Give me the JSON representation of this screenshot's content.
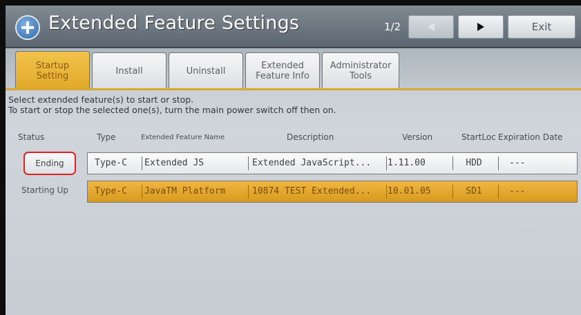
{
  "header": {
    "title": "Extended Feature Settings",
    "page_indicator": "1/2",
    "prev_icon": "triangle-left-icon",
    "next_icon": "triangle-right-icon",
    "exit_label": "Exit"
  },
  "tabs": [
    {
      "line1": "Startup",
      "line2": "Setting",
      "active": true
    },
    {
      "line1": "Install",
      "line2": "",
      "active": false
    },
    {
      "line1": "Uninstall",
      "line2": "",
      "active": false
    },
    {
      "line1": "Extended",
      "line2": "Feature Info",
      "active": false
    },
    {
      "line1": "Administrator",
      "line2": "Tools",
      "active": false
    }
  ],
  "info": {
    "line1": "Select extended feature(s) to start or stop.",
    "line2": "To start or stop the selected one(s), turn the main power switch off then on."
  },
  "columns": {
    "status": "Status",
    "type": "Type",
    "name": "Extended Feature Name",
    "description": "Description",
    "version": "Version",
    "start_loc": "StartLoc",
    "expiration": "Expiration Date"
  },
  "rows": [
    {
      "status": "Ending",
      "type": "Type-C",
      "name": "Extended JS",
      "description": "Extended JavaScript...",
      "version": "1.11.00",
      "start_loc": "HDD",
      "expiration": "---"
    },
    {
      "status": "Starting Up",
      "type": "Type-C",
      "name": "JavaTM Platform",
      "description": "10874 TEST Extended...",
      "version": "10.01.05",
      "start_loc": "SD1",
      "expiration": "---"
    }
  ],
  "colors": {
    "accent": "#e0a92a",
    "highlight_border": "#e02020"
  }
}
